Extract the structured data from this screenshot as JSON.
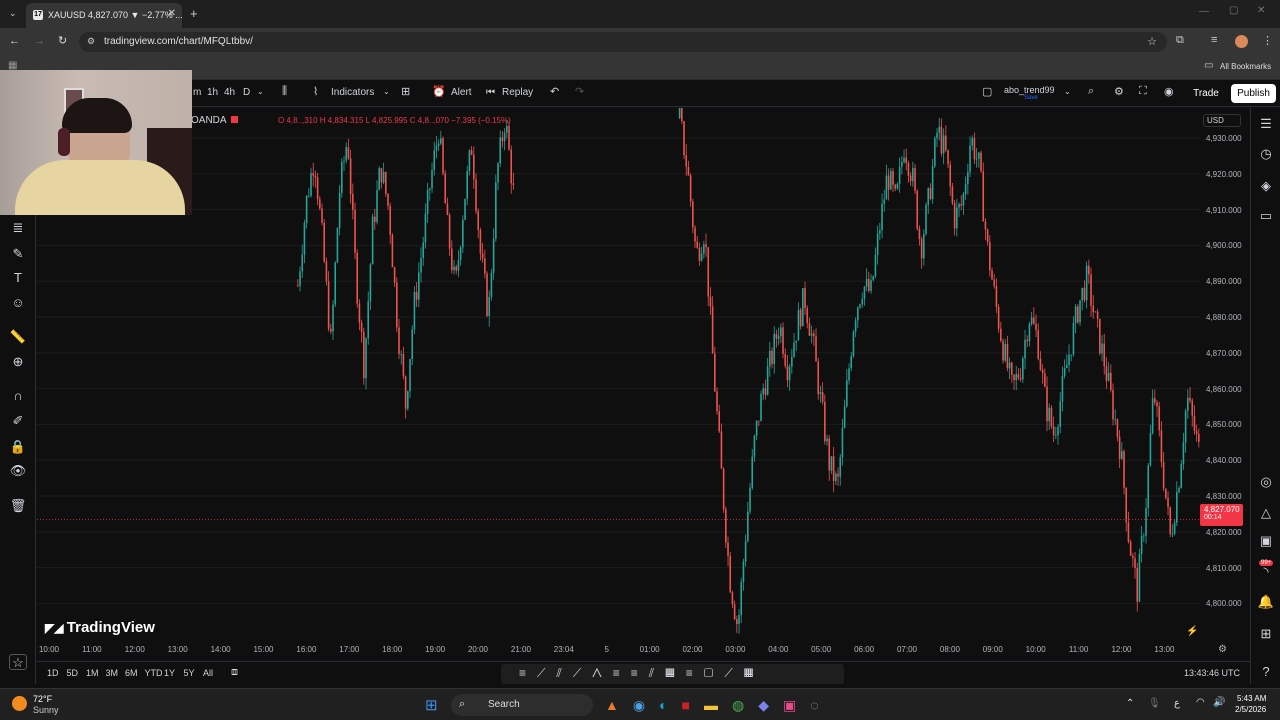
{
  "browser": {
    "tab_title": "XAUUSD 4,827.070 ▼ −2.77% ...",
    "url": "tradingview.com/chart/MFQLtbbv/",
    "bookmarks_label": "All Bookmarks"
  },
  "header": {
    "intervals": [
      "m",
      "1h",
      "4h",
      "D"
    ],
    "indicators_label": "Indicators",
    "alert_label": "Alert",
    "replay_label": "Replay",
    "layout_name": "abo_trend99",
    "layout_status": "Save",
    "trade_label": "Trade",
    "publish_label": "Publish"
  },
  "legend": {
    "symbol_suffix": "OANDA",
    "ohlc_text": "O 4,8..,310  H 4,834.315  L 4,825.995  C 4,8..,070  −7.395 (−0.15%)"
  },
  "price_axis": {
    "currency": "USD",
    "ticks": [
      "4,930.000",
      "4,920.000",
      "4,910.000",
      "4,900.000",
      "4,890.000",
      "4,880.000",
      "4,870.000",
      "4,860.000",
      "4,850.000",
      "4,840.000",
      "4,830.000",
      "4,820.000",
      "4,810.000",
      "4,800.000"
    ],
    "current_price": "4,827.070",
    "countdown": "00:14"
  },
  "time_axis": {
    "ticks": [
      "10:00",
      "11:00",
      "12:00",
      "13:00",
      "14:00",
      "15:00",
      "16:00",
      "17:00",
      "18:00",
      "19:00",
      "20:00",
      "21:00",
      "23:04",
      "5",
      "01:00",
      "02:00",
      "03:00",
      "04:00",
      "05:00",
      "06:00",
      "07:00",
      "08:00",
      "09:00",
      "10:00",
      "11:00",
      "12:00",
      "13:00"
    ]
  },
  "watermark": "TradingView",
  "bottom": {
    "ranges": [
      "1D",
      "5D",
      "1M",
      "3M",
      "6M",
      "YTD",
      "1Y",
      "5Y",
      "All"
    ],
    "clock": "13:43:46 UTC"
  },
  "taskbar": {
    "weather_temp": "72°F",
    "weather_desc": "Sunny",
    "search_label": "Search",
    "time": "5:43 AM",
    "date": "2/5/2026",
    "notif_badge": "99+"
  },
  "colors": {
    "up": "#26a69a",
    "down": "#ef5350",
    "price_tag": "#f23645",
    "bg": "#0f0f0f"
  },
  "chart_data": {
    "type": "candlestick",
    "symbol": "XAUUSD",
    "ylim": [
      4795,
      4935
    ],
    "x_labels": [
      "10:00",
      "11:00",
      "12:00",
      "13:00",
      "14:00",
      "15:00",
      "16:00",
      "17:00",
      "18:00",
      "19:00",
      "20:00",
      "21:00",
      "23:04",
      "5",
      "01:00",
      "02:00",
      "03:00",
      "04:00",
      "05:00",
      "06:00",
      "07:00",
      "08:00",
      "09:00",
      "10:00",
      "11:00",
      "12:00",
      "13:00"
    ],
    "segments": [
      {
        "start_hour": 5.8,
        "end_hour": 10.9,
        "closes": [
          4890,
          4912,
          4925,
          4901,
          4874,
          4915,
          4930,
          4893,
          4868,
          4905,
          4922,
          4910,
          4880,
          4858,
          4884,
          4900,
          4918,
          4932,
          4906,
          4889,
          4912,
          4928,
          4899,
          4882,
          4920,
          4935,
          4915
        ]
      },
      {
        "start_hour": 14.7,
        "end_hour": 27.2,
        "closes": [
          4935,
          4920,
          4898,
          4905,
          4870,
          4840,
          4812,
          4798,
          4825,
          4848,
          4862,
          4870,
          4880,
          4868,
          4878,
          4887,
          4875,
          4858,
          4842,
          4836,
          4860,
          4882,
          4890,
          4888,
          4905,
          4920,
          4912,
          4928,
          4919,
          4900,
          4914,
          4932,
          4925,
          4908,
          4912,
          4930,
          4922,
          4900,
          4885,
          4872,
          4862,
          4868,
          4882,
          4876,
          4858,
          4850,
          4862,
          4874,
          4885,
          4892,
          4880,
          4870,
          4858,
          4846,
          4822,
          4808,
          4830,
          4862,
          4842,
          4822,
          4838,
          4860,
          4850,
          4840,
          4827
        ]
      }
    ],
    "last_price": 4827.07
  }
}
